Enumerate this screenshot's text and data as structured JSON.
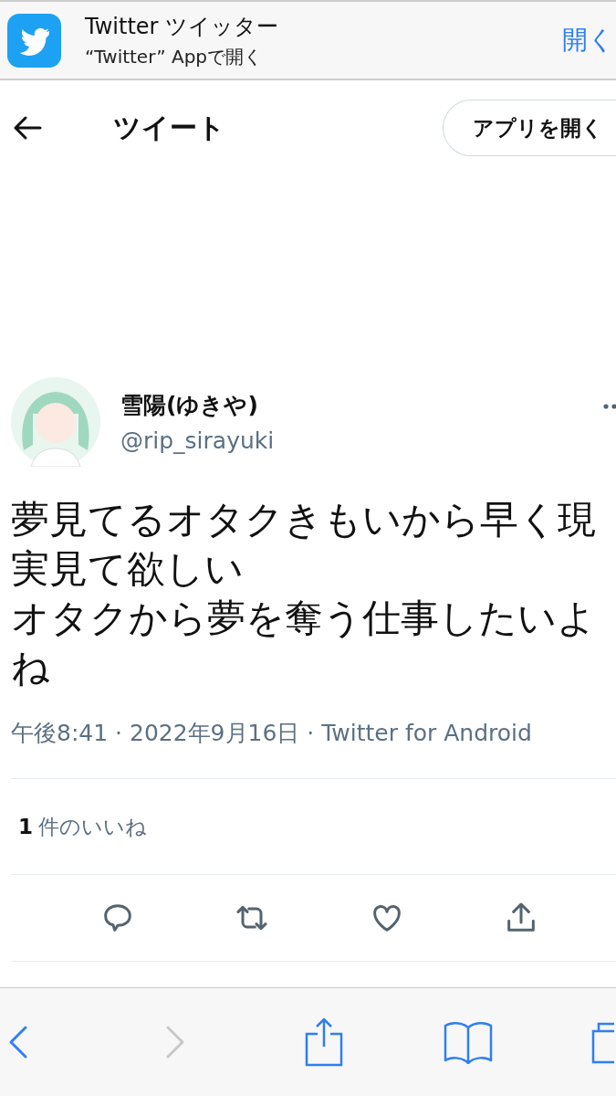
{
  "app_banner": {
    "title": "Twitter ツイッター",
    "subtitle": "“Twitter” Appで開く",
    "action": "開く"
  },
  "header": {
    "title": "ツイート",
    "button": "アプリを開く"
  },
  "tweet": {
    "author": {
      "name": "雪陽(ゆきや)",
      "handle": "@rip_sirayuki"
    },
    "text": [
      "夢見てるオタクきもいから早く現実見て欲しい",
      "オタクから夢を奪う仕事したいよね"
    ],
    "meta": "午後8:41 · 2022年9月16日 · Twitter for Android",
    "likes": {
      "count": "1",
      "label": "件のいいね"
    }
  },
  "browser_toolbar": {
    "back": {
      "disabled": false
    },
    "forward": {
      "disabled": true
    }
  }
}
